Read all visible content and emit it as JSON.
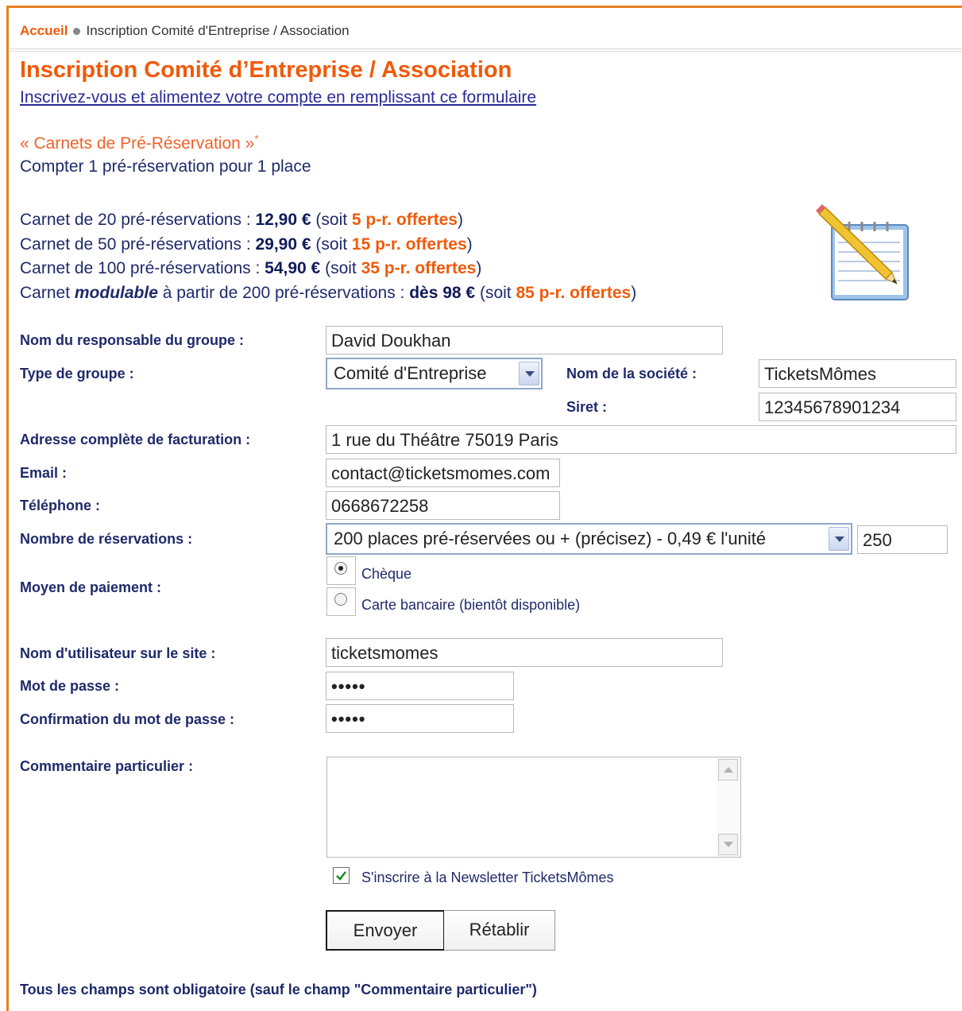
{
  "breadcrumb": {
    "home": "Accueil",
    "current": "Inscription Comité d'Entreprise / Association"
  },
  "page": {
    "title": "Inscription Comité d’Entreprise / Association",
    "subtitle": "Inscrivez-vous et alimentez votre compte en remplissant ce formulaire"
  },
  "carnets": {
    "title": "« Carnets de Pré-Réservation »",
    "asterisk": "*",
    "note": "Compter 1 pré-réservation pour 1 place",
    "lines": [
      {
        "prefix": "Carnet de 20 pré-réservations : ",
        "price": "12,90 €",
        "mid": " (soit ",
        "offer": "5 p-r. offertes",
        "suffix": ")"
      },
      {
        "prefix": "Carnet de 50 pré-réservations : ",
        "price": "29,90 €",
        "mid": " (soit ",
        "offer": "15 p-r. offertes",
        "suffix": ")"
      },
      {
        "prefix": "Carnet de 100 pré-réservations : ",
        "price": "54,90 €",
        "mid": " (soit ",
        "offer": "35 p-r. offertes",
        "suffix": ")"
      }
    ],
    "modulable": {
      "prefix": "Carnet ",
      "emph": "modulable",
      "middle": " à partir de 200 pré-réservations : ",
      "price": "dès 98 €",
      "mid": " (soit ",
      "offer": "85 p-r. offertes",
      "suffix": ")"
    },
    "icon": "notepad-pencil-icon"
  },
  "form": {
    "responsable_label": "Nom du responsable du groupe :",
    "responsable_value": "David Doukhan",
    "type_label": "Type de groupe :",
    "type_value": "Comité d'Entreprise",
    "societe_label": "Nom de la société :",
    "societe_value": "TicketsMômes",
    "siret_label": "Siret :",
    "siret_value": "12345678901234",
    "adresse_label": "Adresse complète de facturation :",
    "adresse_value": "1 rue du Théâtre 75019 Paris",
    "email_label": "Email :",
    "email_value": "contact@ticketsmomes.com",
    "telephone_label": "Téléphone :",
    "telephone_value": "0668672258",
    "reservations_label": "Nombre de réservations :",
    "reservations_value": "200 places pré-réservées ou + (précisez) - 0,49 € l'unité",
    "reservations_qty": "250",
    "paiement_label": "Moyen de paiement :",
    "paiement_options": [
      {
        "label": "Chèque",
        "checked": true
      },
      {
        "label": "Carte bancaire (bientôt disponible)",
        "checked": false
      }
    ],
    "username_label": "Nom d'utilisateur sur le site :",
    "username_value": "ticketsmomes",
    "password_label": "Mot de passe :",
    "password_value": "•••••",
    "password_confirm_label": "Confirmation du mot de passe :",
    "password_confirm_value": "•••••",
    "comment_label": "Commentaire particulier :",
    "comment_value": "",
    "newsletter_label": "S'inscrire à la Newsletter TicketsMômes",
    "newsletter_checked": true,
    "submit_label": "Envoyer",
    "reset_label": "Rétablir"
  },
  "footer_note": "Tous les champs sont obligatoire (sauf le champ \"Commentaire particulier\")",
  "colors": {
    "accent": "#f05a0a",
    "text": "#1f2a6b",
    "border": "#e8801e"
  }
}
